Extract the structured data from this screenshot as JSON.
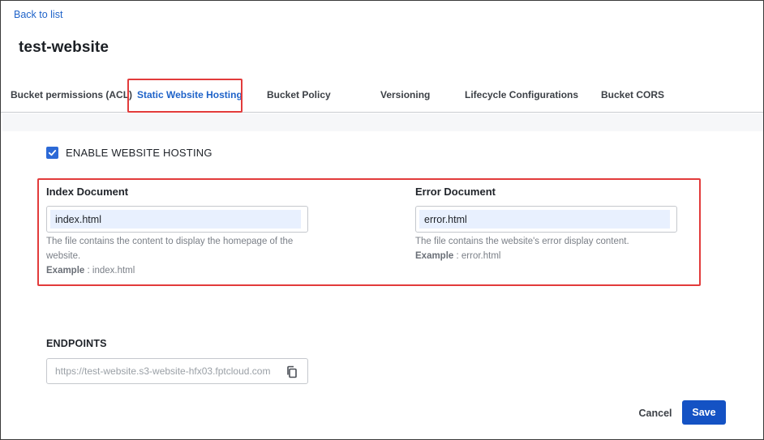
{
  "nav": {
    "back_label": "Back to list"
  },
  "page": {
    "title": "test-website"
  },
  "tabs": [
    {
      "label": "Bucket permissions (ACL)"
    },
    {
      "label": "Static Website Hosting"
    },
    {
      "label": "Bucket Policy"
    },
    {
      "label": "Versioning"
    },
    {
      "label": "Lifecycle Configurations"
    },
    {
      "label": "Bucket CORS"
    }
  ],
  "active_tab": "Static Website Hosting",
  "hosting": {
    "enable_label": "ENABLE WEBSITE HOSTING",
    "enabled": true
  },
  "index_doc": {
    "title": "Index Document",
    "value": "index.html",
    "hint": "The file contains the content to display the homepage of the website.",
    "example_label": "Example",
    "example_value": ": index.html"
  },
  "error_doc": {
    "title": "Error Document",
    "value": "error.html",
    "hint": "The file contains the website's error display content.",
    "example_label": "Example",
    "example_value": ": error.html"
  },
  "endpoints": {
    "title": "ENDPOINTS",
    "value": "https://test-website.s3-website-hfx03.fptcloud.com"
  },
  "actions": {
    "cancel_label": "Cancel",
    "save_label": "Save"
  },
  "colors": {
    "accent": "#1f63c9",
    "primary_button": "#1452c4",
    "highlight_border": "#e23b3b"
  },
  "icons": {
    "checkbox": "check-icon",
    "copy": "copy-icon"
  }
}
